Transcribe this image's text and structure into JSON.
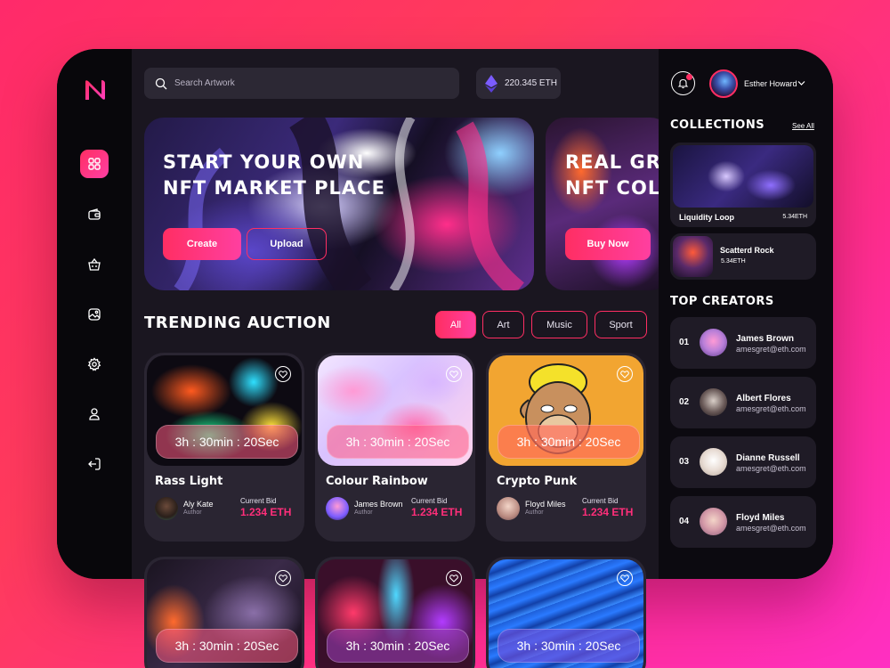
{
  "search": {
    "placeholder": "Search Artwork"
  },
  "wallet": {
    "balance": "220.345 ETH"
  },
  "user": {
    "name": "Esther Howard"
  },
  "nav": [
    {
      "icon": "grid-icon",
      "active": true
    },
    {
      "icon": "wallet-icon"
    },
    {
      "icon": "basket-icon"
    },
    {
      "icon": "image-icon"
    },
    {
      "icon": "gear-icon"
    },
    {
      "icon": "user-icon"
    },
    {
      "icon": "logout-icon"
    }
  ],
  "banners": [
    {
      "title_line1": "START YOUR OWN",
      "title_line2": "NFT MARKET PLACE",
      "primary": "Create",
      "secondary": "Upload"
    },
    {
      "title_line1": "REAL GR",
      "title_line2": "NFT COL",
      "primary": "Buy Now"
    }
  ],
  "trending": {
    "title": "TRENDING AUCTION",
    "filters": [
      "All",
      "Art",
      "Music",
      "Sport"
    ],
    "active_filter": "All",
    "timer": "3h : 30min : 20Sec",
    "bid_label": "Current Bid",
    "author_label": "Author",
    "cards": [
      {
        "name": "Rass Light",
        "author": "Aly Kate",
        "bid": "1.234 ETH"
      },
      {
        "name": "Colour Rainbow",
        "author": "James Brown",
        "bid": "1.234 ETH"
      },
      {
        "name": "Crypto Punk",
        "author": "Floyd Miles",
        "bid": "1.234 ETH"
      }
    ]
  },
  "collections": {
    "title": "COLLECTIONS",
    "see_all": "See All",
    "items": [
      {
        "name": "Liquidity Loop",
        "price": "5.34ETH"
      },
      {
        "name": "Scatterd Rock",
        "price": "5.34ETH"
      }
    ]
  },
  "creators": {
    "title": "TOP CREATORS",
    "items": [
      {
        "rank": "01",
        "name": "James Brown",
        "email": "amesgret@eth.com"
      },
      {
        "rank": "02",
        "name": "Albert Flores",
        "email": "amesgret@eth.com"
      },
      {
        "rank": "03",
        "name": "Dianne Russell",
        "email": "amesgret@eth.com"
      },
      {
        "rank": "04",
        "name": "Floyd Miles",
        "email": "amesgret@eth.com"
      }
    ]
  },
  "colors": {
    "accent": "#ff2e63",
    "accent2": "#ff3fa0",
    "bg": "#1a1620"
  }
}
